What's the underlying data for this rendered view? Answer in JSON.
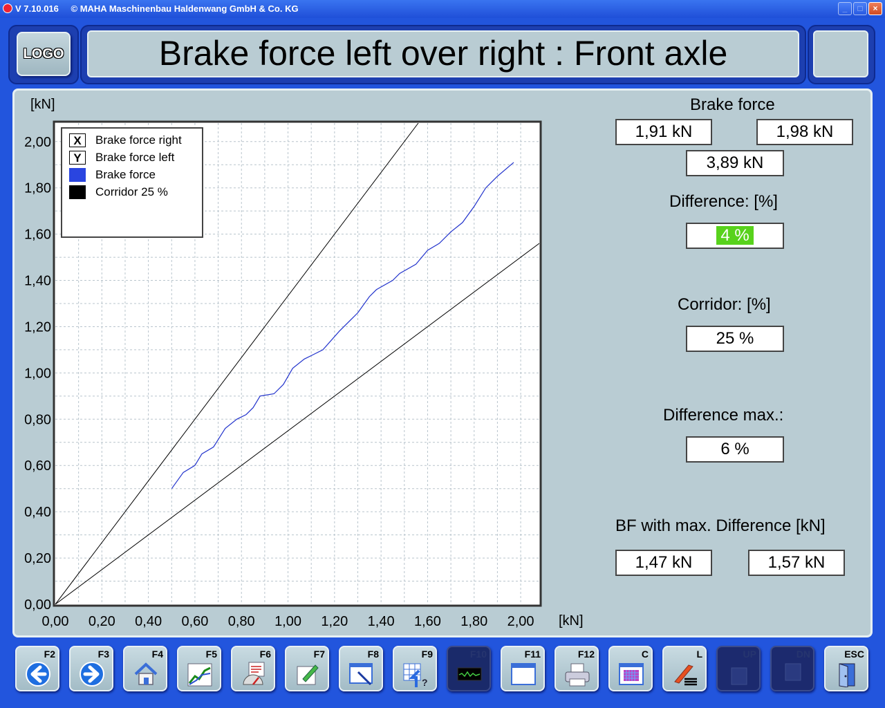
{
  "window": {
    "version": "V 7.10.016",
    "copyright": "© MAHA Maschinenbau Haldenwang GmbH & Co. KG",
    "controls": [
      "minimize",
      "maximize",
      "close"
    ]
  },
  "header": {
    "logo_label": "LOGO",
    "title": "Brake force left over right : Front axle"
  },
  "chart_data": {
    "type": "line",
    "xlabel": "[kN]",
    "ylabel": "[kN]",
    "xlim": [
      0,
      2.08
    ],
    "ylim": [
      0,
      2.08
    ],
    "x_ticks": [
      "0,00",
      "0,20",
      "0,40",
      "0,60",
      "0,80",
      "1,00",
      "1,20",
      "1,40",
      "1,60",
      "1,80",
      "2,00"
    ],
    "y_ticks": [
      "0,00",
      "0,20",
      "0,40",
      "0,60",
      "0,80",
      "1,00",
      "1,20",
      "1,40",
      "1,60",
      "1,80",
      "2,00"
    ],
    "grid": true,
    "legend_position": "top-left",
    "legend": [
      {
        "symbol": "X",
        "label": "Brake force right"
      },
      {
        "symbol": "Y",
        "label": "Brake force left"
      },
      {
        "symbol": "blue",
        "label": "Brake force"
      },
      {
        "symbol": "black",
        "label": "Corridor  25 %"
      }
    ],
    "series": [
      {
        "name": "Brake force",
        "color": "#2233cc",
        "points": [
          [
            0.5,
            0.5
          ],
          [
            0.55,
            0.57
          ],
          [
            0.6,
            0.6
          ],
          [
            0.63,
            0.65
          ],
          [
            0.68,
            0.68
          ],
          [
            0.73,
            0.76
          ],
          [
            0.78,
            0.8
          ],
          [
            0.82,
            0.82
          ],
          [
            0.85,
            0.85
          ],
          [
            0.88,
            0.9
          ],
          [
            0.94,
            0.91
          ],
          [
            0.98,
            0.95
          ],
          [
            1.02,
            1.02
          ],
          [
            1.07,
            1.06
          ],
          [
            1.11,
            1.08
          ],
          [
            1.15,
            1.1
          ],
          [
            1.22,
            1.18
          ],
          [
            1.3,
            1.26
          ],
          [
            1.35,
            1.33
          ],
          [
            1.38,
            1.36
          ],
          [
            1.45,
            1.4
          ],
          [
            1.48,
            1.43
          ],
          [
            1.55,
            1.47
          ],
          [
            1.6,
            1.53
          ],
          [
            1.65,
            1.56
          ],
          [
            1.7,
            1.61
          ],
          [
            1.75,
            1.65
          ],
          [
            1.8,
            1.72
          ],
          [
            1.85,
            1.8
          ],
          [
            1.9,
            1.85
          ],
          [
            1.97,
            1.91
          ]
        ]
      },
      {
        "name": "Corridor upper",
        "color": "#000000",
        "slope": 1.333,
        "points": [
          [
            0,
            0
          ],
          [
            1.56,
            2.08
          ]
        ]
      },
      {
        "name": "Corridor lower",
        "color": "#000000",
        "slope": 0.75,
        "points": [
          [
            0,
            0
          ],
          [
            2.08,
            1.56
          ]
        ]
      }
    ]
  },
  "results": {
    "brake_force_label": "Brake force",
    "bf_right": "1,91 kN",
    "bf_left": "1,98 kN",
    "bf_total": "3,89 kN",
    "difference_label": "Difference: [%]",
    "difference_value": "4 %",
    "difference_color": "#58d21c",
    "corridor_label": "Corridor: [%]",
    "corridor_value": "25 %",
    "difference_max_label": "Difference max.:",
    "difference_max_value": "6 %",
    "bf_max_diff_label": "BF with max. Difference [kN]",
    "bf_max_diff_right": "1,47 kN",
    "bf_max_diff_left": "1,57 kN"
  },
  "toolbar": [
    {
      "key": "F2",
      "icon": "back-arrow-icon",
      "enabled": true
    },
    {
      "key": "F3",
      "icon": "forward-arrow-icon",
      "enabled": true
    },
    {
      "key": "F4",
      "icon": "home-icon",
      "enabled": true
    },
    {
      "key": "F5",
      "icon": "line-chart-icon",
      "enabled": true
    },
    {
      "key": "F6",
      "icon": "gauge-report-icon",
      "enabled": true
    },
    {
      "key": "F7",
      "icon": "edit-note-icon",
      "enabled": true
    },
    {
      "key": "F8",
      "icon": "window-pen-icon",
      "enabled": true
    },
    {
      "key": "F9",
      "icon": "calculator-help-icon",
      "enabled": true
    },
    {
      "key": "F10",
      "icon": "oscilloscope-icon",
      "enabled": false
    },
    {
      "key": "F11",
      "icon": "window-icon",
      "enabled": true
    },
    {
      "key": "F12",
      "icon": "printer-icon",
      "enabled": true
    },
    {
      "key": "C",
      "icon": "color-grid-icon",
      "enabled": true
    },
    {
      "key": "L",
      "icon": "brush-lines-icon",
      "enabled": true
    },
    {
      "key": "UP",
      "icon": "up-icon",
      "enabled": false
    },
    {
      "key": "DN",
      "icon": "down-icon",
      "enabled": false
    },
    {
      "key": "ESC",
      "icon": "exit-door-icon",
      "enabled": true
    }
  ]
}
